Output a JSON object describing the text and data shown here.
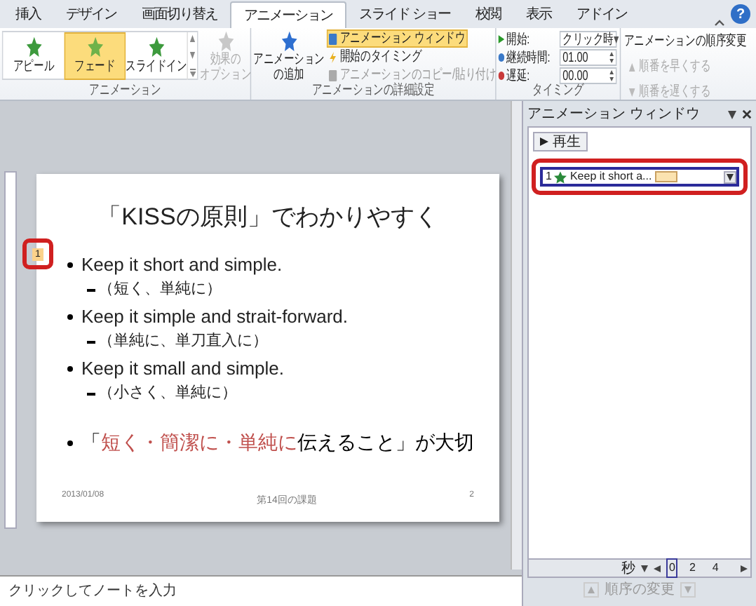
{
  "tabs": [
    {
      "label": "挿入",
      "selected": false
    },
    {
      "label": "デザイン",
      "selected": false
    },
    {
      "label": "画面切り替え",
      "selected": false
    },
    {
      "label": "アニメーション",
      "selected": true
    },
    {
      "label": "スライド ショー",
      "selected": false
    },
    {
      "label": "校閲",
      "selected": false
    },
    {
      "label": "表示",
      "selected": false
    },
    {
      "label": "アドイン",
      "selected": false
    }
  ],
  "help_button": "?",
  "ribbon": {
    "animation_group": {
      "label": "アニメーション",
      "effects": [
        {
          "label": "アピール",
          "selected": false
        },
        {
          "label": "フェード",
          "selected": true
        },
        {
          "label": "スライドイン",
          "selected": false
        }
      ],
      "effect_options": {
        "label_lines": [
          "効果の",
          "オプション"
        ],
        "disabled": true
      }
    },
    "advanced_group": {
      "label": "アニメーションの詳細設定",
      "add_animation_lines": [
        "アニメーション",
        "の追加"
      ],
      "commands": [
        {
          "kind": "pane",
          "label": "アニメーション ウィンドウ",
          "selected": true,
          "disabled": false
        },
        {
          "kind": "trigger",
          "label": "開始のタイミング",
          "selected": false,
          "disabled": false
        },
        {
          "kind": "painter",
          "label": "アニメーションのコピー/貼り付け",
          "selected": false,
          "disabled": true
        }
      ]
    },
    "timing_group": {
      "label": "タイミング",
      "start": {
        "label": "開始:",
        "value": "クリック時"
      },
      "duration": {
        "label": "継続時間:",
        "value": "01.00"
      },
      "delay": {
        "label": "遅延:",
        "value": "00.00"
      }
    },
    "reorder_group": {
      "title": "アニメーションの順序変更",
      "earlier": "順番を早くする",
      "later": "順番を遅くする",
      "disabled": true
    }
  },
  "slide": {
    "title": "「KISSの原則」でわかりやすく",
    "animation_tag": "1",
    "bullets": [
      {
        "text": "Keep it short and simple.",
        "children": [
          {
            "text": "（短く、単純に）"
          }
        ]
      },
      {
        "text": "Keep it simple and strait-forward.",
        "children": [
          {
            "text": "（単純に、単刀直入に）"
          }
        ]
      },
      {
        "text": "Keep it small and simple.",
        "children": [
          {
            "text": "（小さく、単純に）"
          }
        ]
      }
    ],
    "key_point": [
      {
        "text": "「",
        "emphasis": false
      },
      {
        "text": "短く・簡潔に・単純に",
        "emphasis": true
      },
      {
        "text": "伝えること」が大切",
        "emphasis": false
      }
    ],
    "footer": {
      "date": "2013/01/08",
      "center": "第14回の課題",
      "page": "2"
    }
  },
  "notes": {
    "placeholder": "クリックしてノートを入力"
  },
  "animation_pane": {
    "title": "アニメーション ウィンドウ",
    "play": "再生",
    "items": [
      {
        "number": "1",
        "label": "Keep it short a...",
        "selected": true
      }
    ],
    "seconds": "秒",
    "timeline": [
      "0",
      "2",
      "4"
    ],
    "reorder": "順序の変更"
  }
}
